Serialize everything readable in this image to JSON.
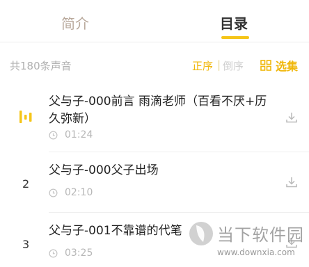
{
  "tabs": {
    "intro": "简介",
    "toc": "目录"
  },
  "toolbar": {
    "count_label": "共180条声音",
    "sort_asc": "正序",
    "sort_separator": "|",
    "sort_desc": "倒序",
    "select_label": "选集"
  },
  "episodes": [
    {
      "index": "",
      "title": "父与子-000前言 雨滴老师（百看不厌+历久弥新）",
      "duration": "01:24",
      "playing": true
    },
    {
      "index": "2",
      "title": "父与子-000父子出场",
      "duration": "02:10",
      "playing": false
    },
    {
      "index": "3",
      "title": "父与子-001不靠谱的代笔",
      "duration": "03:25",
      "playing": false
    }
  ],
  "watermark": {
    "name": "当下软件园",
    "url": "www.downxia.com"
  },
  "colors": {
    "accent": "#f0b70a",
    "indicator": "#f5c518",
    "muted": "#b7b7b7"
  }
}
